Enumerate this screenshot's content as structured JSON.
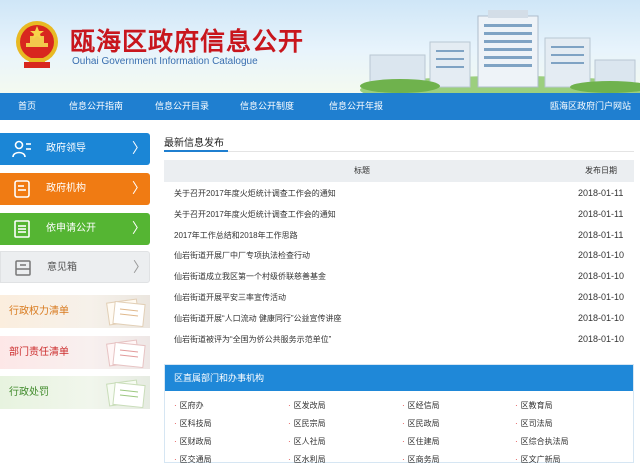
{
  "header": {
    "title": "瓯海区政府信息公开",
    "subtitle": "Ouhai Government Information Catalogue"
  },
  "nav": {
    "items": [
      "首页",
      "信息公开指南",
      "信息公开目录",
      "信息公开制度",
      "信息公开年报"
    ],
    "portal_link": "瓯海区政府门户网站"
  },
  "sidebar": {
    "buttons": [
      {
        "label": "政府领导",
        "icon": "people-icon",
        "color": "#1b86d6"
      },
      {
        "label": "政府机构",
        "icon": "document-icon",
        "color": "#f07b13"
      },
      {
        "label": "依申请公开",
        "icon": "list-document-icon",
        "color": "#55b533"
      },
      {
        "label": "意见箱",
        "icon": "inbox-icon",
        "color": "#eceef0"
      }
    ],
    "chevron": "〉",
    "banners": [
      {
        "label": "行政权力清单"
      },
      {
        "label": "部门责任清单"
      },
      {
        "label": "行政处罚"
      }
    ]
  },
  "latest": {
    "section_title": "最新信息发布",
    "col_title": "标题",
    "col_date": "发布日期",
    "rows": [
      {
        "title": "关于召开2017年度火炬统计调查工作会的通知",
        "date": "2018-01-11"
      },
      {
        "title": "关于召开2017年度火炬统计调查工作会的通知",
        "date": "2018-01-11"
      },
      {
        "title": "2017年工作总结和2018年工作思路",
        "date": "2018-01-11"
      },
      {
        "title": "仙岩街道开展厂中厂专项执法检查行动",
        "date": "2018-01-10"
      },
      {
        "title": "仙岩街道成立我区第一个村级侨联慈善基金",
        "date": "2018-01-10"
      },
      {
        "title": "仙岩街道开展平安三率宣传活动",
        "date": "2018-01-10"
      },
      {
        "title": "仙岩街道开展“人口流动 健康同行”公益宣传讲座",
        "date": "2018-01-10"
      },
      {
        "title": "仙岩街道被评为“全国为侨公共服务示范单位”",
        "date": "2018-01-10"
      }
    ]
  },
  "departments": {
    "title": "区直属部门和办事机构",
    "bullet": "·",
    "items": [
      "区府办",
      "区发改局",
      "区经信局",
      "区教育局",
      "区科技局",
      "区民宗局",
      "区民政局",
      "区司法局",
      "区财政局",
      "区人社局",
      "区住建局",
      "区综合执法局",
      "区交通局",
      "区水利局",
      "区商务局",
      "区文广新局"
    ]
  },
  "colors": {
    "nav_blue": "#1f7fd0",
    "title_red": "#c8161d",
    "orange": "#f07b13",
    "green": "#55b533"
  }
}
